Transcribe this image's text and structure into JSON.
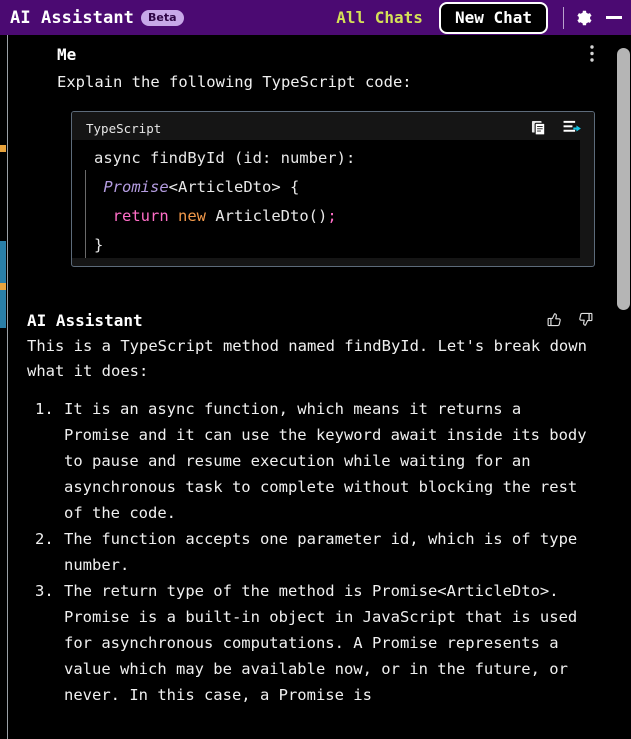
{
  "titlebar": {
    "app_name": "AI Assistant",
    "badge": "Beta",
    "all_chats_label": "All Chats",
    "new_chat_label": "New Chat",
    "settings_icon": "gear-icon",
    "minimize_icon": "minimize-icon",
    "bg_color": "#4b0a72",
    "accent_color": "#d4e157",
    "badge_bg": "#c7a8e8"
  },
  "user_message": {
    "author": "Me",
    "text": "Explain the following TypeScript code:",
    "menu_icon": "more-options-icon"
  },
  "code_block": {
    "language": "TypeScript",
    "copy_icon": "copy-icon",
    "insert_icon": "insert-code-icon",
    "lines": [
      [
        {
          "t": "async findById (id: number):",
          "c": "tok-white"
        }
      ],
      [
        {
          "t": " ",
          "c": "tok-white"
        },
        {
          "t": "Promise",
          "c": "tok-italic-purple"
        },
        {
          "t": "<ArticleDto> {",
          "c": "tok-white"
        }
      ],
      [
        {
          "t": "  ",
          "c": "tok-white"
        },
        {
          "t": "return",
          "c": "tok-pink"
        },
        {
          "t": " ",
          "c": "tok-white"
        },
        {
          "t": "new",
          "c": "tok-orange"
        },
        {
          "t": " ArticleDto()",
          "c": "tok-white"
        },
        {
          "t": ";",
          "c": "tok-pink"
        }
      ],
      [
        {
          "t": "}",
          "c": "tok-white"
        }
      ]
    ]
  },
  "assistant_message": {
    "author": "AI Assistant",
    "thumbs_up_icon": "thumbs-up-icon",
    "thumbs_down_icon": "thumbs-down-icon",
    "intro": "This is a TypeScript method named findById. Let's break down what it does:",
    "list_items": [
      "It is an async function, which means it returns a Promise and it can use the keyword await inside its body to pause and resume execution while waiting for an asynchronous task to complete without blocking the rest of the code.",
      "The function accepts one parameter id, which is of type number.",
      "The return type of the method is Promise<ArticleDto>. Promise is a built-in object in JavaScript that is used for asynchronous computations. A Promise represents a value which may be available now, or in the future, or never. In this case, a Promise is"
    ]
  },
  "scrollbar": {
    "thumb_color": "#b5b5b5"
  }
}
